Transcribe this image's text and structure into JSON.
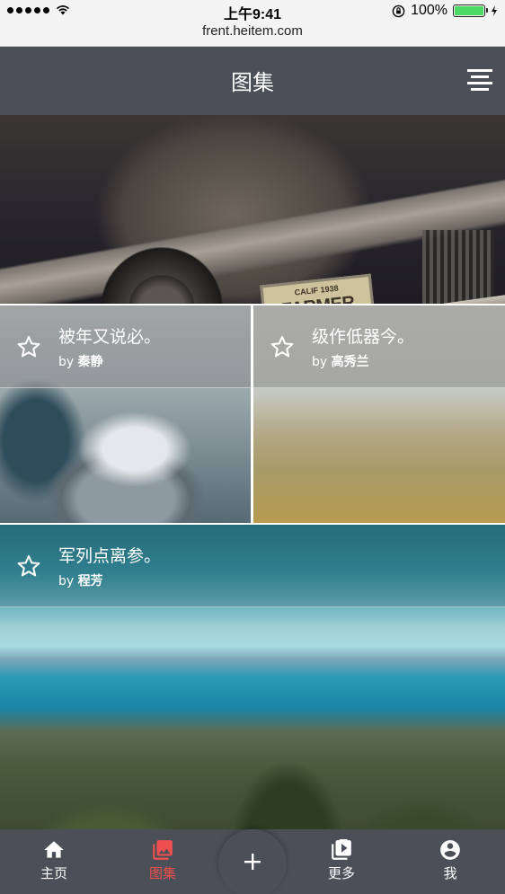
{
  "status_bar": {
    "time": "上午9:41",
    "battery": "100%",
    "signal_icon": "signal-dots-icon",
    "wifi_icon": "wifi-icon",
    "lock_icon": "orientation-lock-icon",
    "charge_icon": "charging-bolt-icon"
  },
  "browser": {
    "url": "frent.heitem.com"
  },
  "header": {
    "title": "图集",
    "menu_icon": "align-center-menu-icon"
  },
  "gallery": {
    "featured": {
      "plate_top": "CALIF 1938",
      "plate_text": "FARMER BOY"
    },
    "items": [
      {
        "title": "被年又说必。",
        "by": "by",
        "author": "秦静"
      },
      {
        "title": "级作低器今。",
        "by": "by",
        "author": "高秀兰"
      },
      {
        "title": "军列点离参。",
        "by": "by",
        "author": "程芳"
      }
    ]
  },
  "bottom_nav": {
    "items": [
      {
        "label": "主页",
        "icon": "home-icon"
      },
      {
        "label": "图集",
        "icon": "images-icon",
        "active": true
      },
      {
        "label": "更多",
        "icon": "video-library-icon"
      },
      {
        "label": "我",
        "icon": "account-circle-icon"
      }
    ],
    "fab_icon": "plus-icon"
  },
  "colors": {
    "header_bg": "#4b4f57",
    "active": "#ef4f4f",
    "battery": "#4cd964"
  }
}
